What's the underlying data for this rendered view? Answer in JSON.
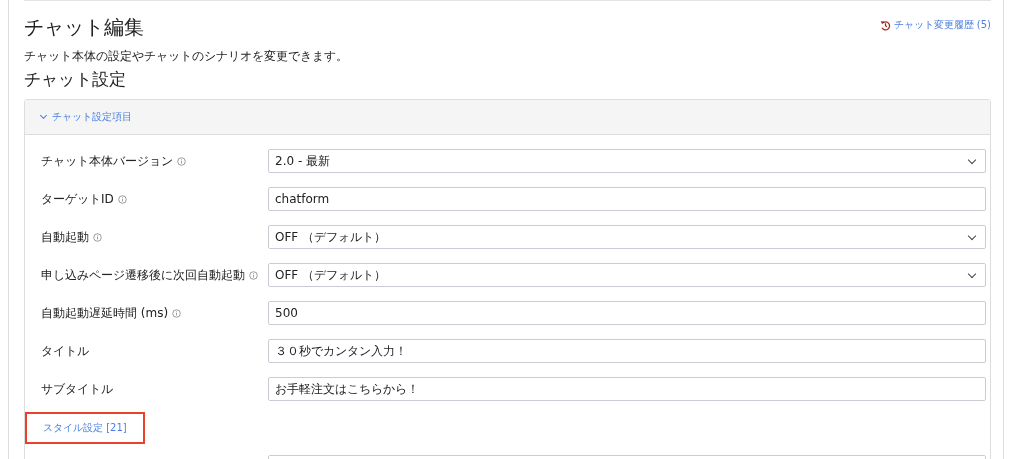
{
  "page": {
    "title": "チャット編集",
    "history_link": "チャット変更履歴 (5)",
    "description": "チャット本体の設定やチャットのシナリオを変更できます。"
  },
  "section": {
    "title": "チャット設定",
    "panel": {
      "header": "チャット設定項目",
      "expanded": true,
      "fields": [
        {
          "label": "チャット本体バージョン",
          "info": true,
          "kind": "select",
          "value": "2.0 - 最新"
        },
        {
          "label": "ターゲットID",
          "info": true,
          "kind": "text",
          "value": "chatform"
        },
        {
          "label": "自動起動",
          "info": true,
          "kind": "select",
          "value": "OFF （デフォルト）"
        },
        {
          "label": "申し込みページ遷移後に次回自動起動",
          "info": true,
          "kind": "select",
          "value": "OFF （デフォルト）"
        },
        {
          "label": "自動起動遅延時間 (ms)",
          "info": true,
          "kind": "text",
          "value": "500"
        },
        {
          "label": "タイトル",
          "info": false,
          "kind": "text",
          "value": "３０秒でカンタン入力！"
        },
        {
          "label": "サブタイトル",
          "info": false,
          "kind": "text",
          "value": "お手軽注文はこちらから！"
        }
      ],
      "style_link": {
        "label": "スタイル設定 [21]",
        "highlighted": true
      },
      "more_fields": [
        {
          "kind": "text"
        }
      ]
    }
  }
}
